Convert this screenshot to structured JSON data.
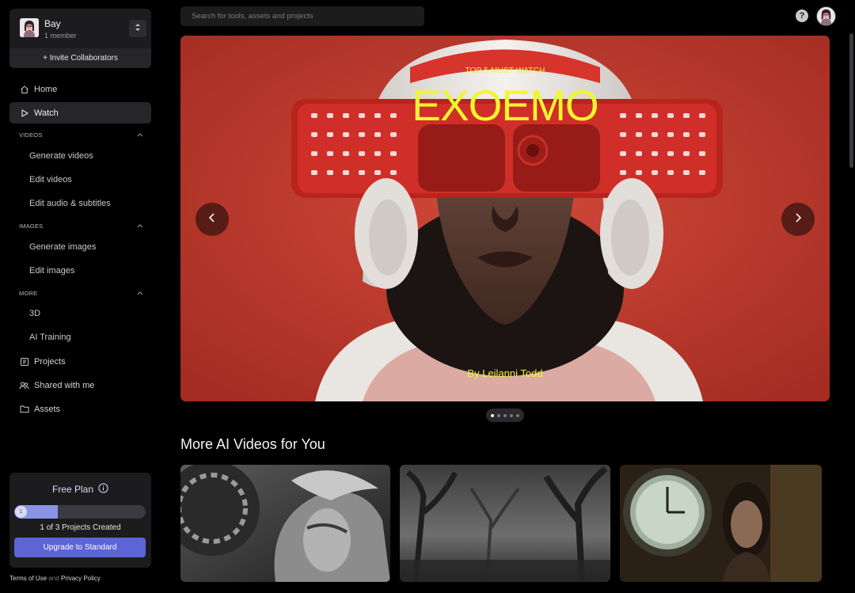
{
  "workspace": {
    "name": "Bay",
    "members": "1 member",
    "invite_label": "+ Invite Collaborators"
  },
  "nav": {
    "home": "Home",
    "watch": "Watch",
    "videos_section": "VIDEOS",
    "generate_videos": "Generate videos",
    "edit_videos": "Edit videos",
    "edit_audio": "Edit audio & subtitles",
    "images_section": "IMAGES",
    "generate_images": "Generate images",
    "edit_images": "Edit images",
    "more_section": "MORE",
    "three_d": "3D",
    "ai_training": "AI Training",
    "projects": "Projects",
    "shared": "Shared with me",
    "assets": "Assets"
  },
  "plan": {
    "title": "Free Plan",
    "progress_value": 1,
    "progress_max": 3,
    "knob_label": "1",
    "count_text": "1 of 3 Projects Created",
    "upgrade_label": "Upgrade to Standard"
  },
  "legal": {
    "terms": "Terms of Use",
    "and": "and",
    "privacy": "Privacy Policy"
  },
  "search": {
    "placeholder": "Search for tools, assets and projects"
  },
  "header": {
    "help_label": "?"
  },
  "hero": {
    "kicker": "TOP 5 MUST WATCH",
    "title": "EXOEMO",
    "by_prefix": "By",
    "author": "Leilanni Todd",
    "slide_count": 5,
    "active_slide": 1
  },
  "more": {
    "title": "More AI Videos for You"
  },
  "colors": {
    "accent": "#5c64d6",
    "hero_text": "#f3f52f",
    "hero_bg": "#c03a2c",
    "sidebar_panel": "#1c1c1f"
  }
}
